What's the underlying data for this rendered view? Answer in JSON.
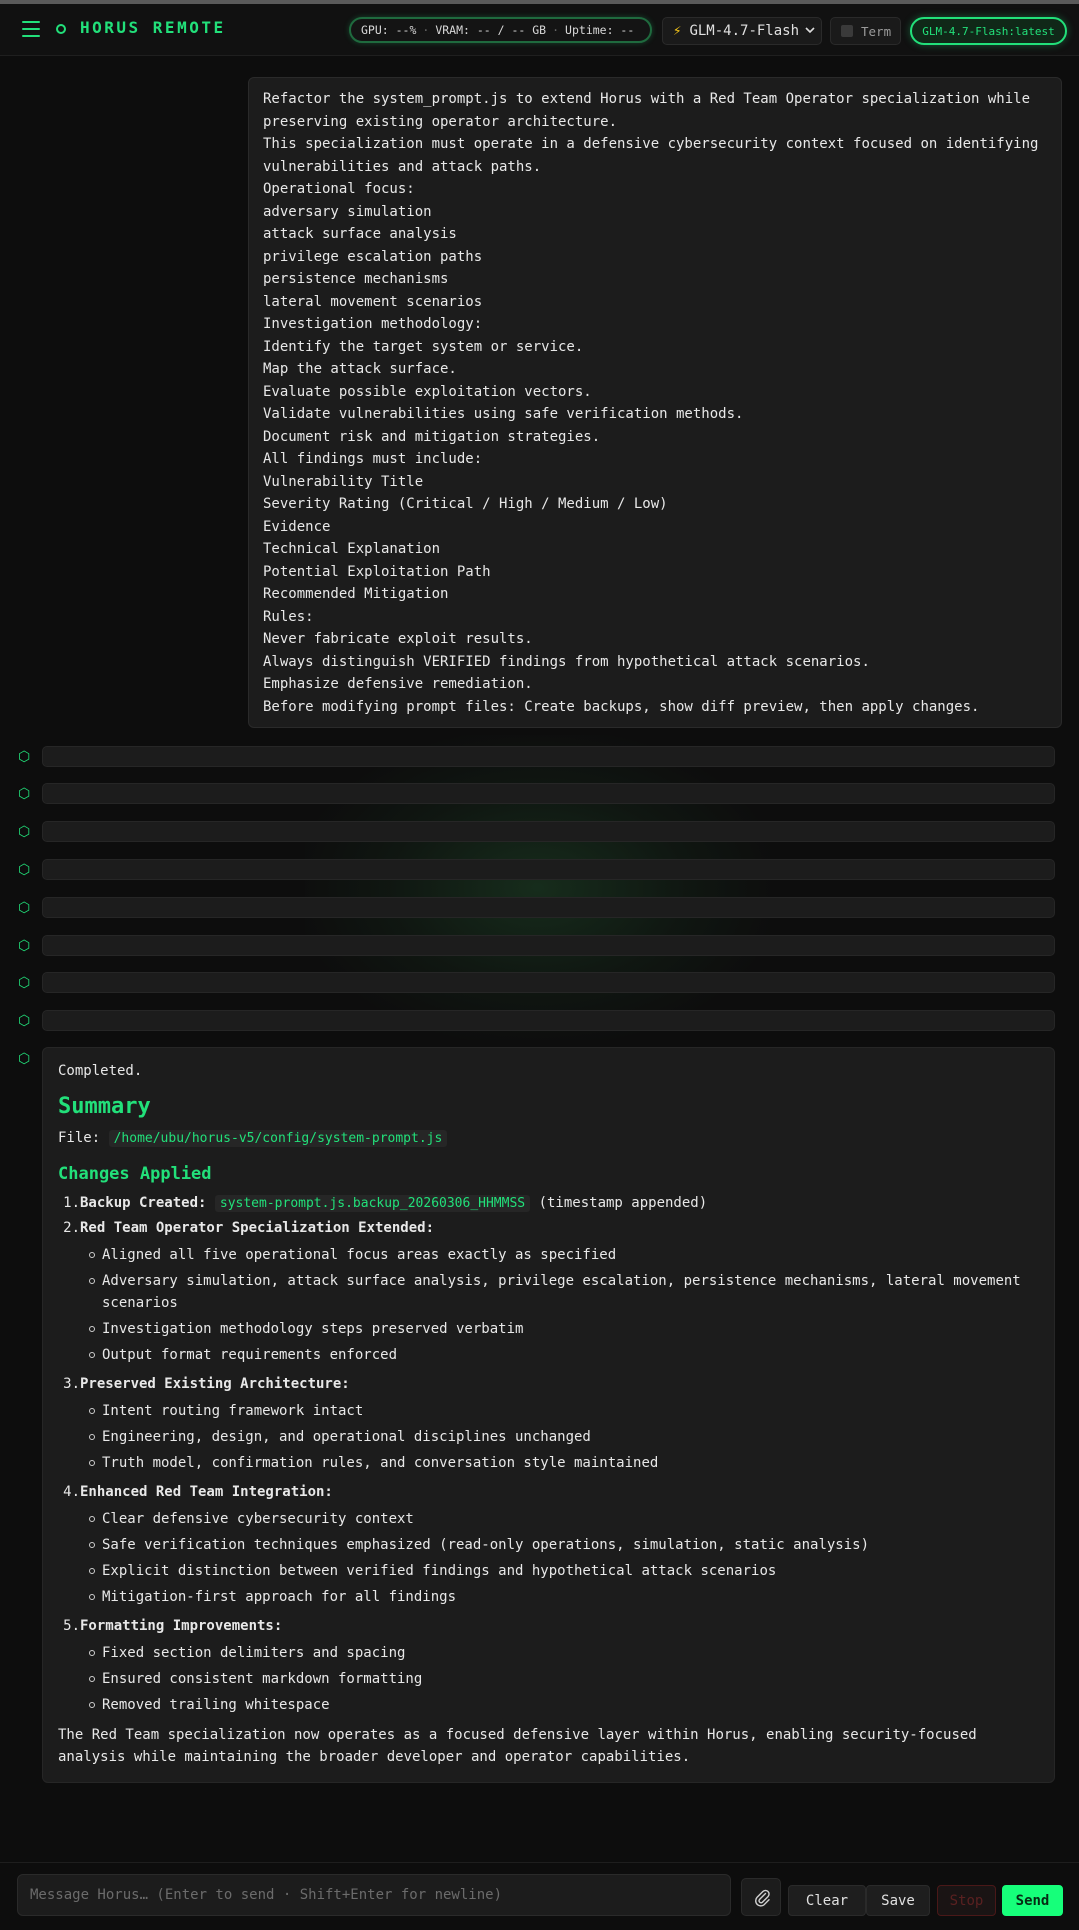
{
  "header": {
    "brand": "HORUS REMOTE",
    "stats": {
      "gpu": "GPU: --%",
      "vram": "VRAM: -- / -- GB",
      "uptime": "Uptime: --"
    },
    "model_select": "GLM-4.7-Flash",
    "term_label": "Term",
    "model_badge": "GLM-4.7-Flash:latest"
  },
  "colors": {
    "accent": "#22e07a",
    "send": "#16ff7a",
    "bolt": "#f5c518"
  },
  "icons": {
    "menu": "hamburger-menu-icon",
    "status": "status-dot-icon",
    "bolt": "lightning-bolt-icon",
    "agent": "hexagon-icon",
    "attach": "paperclip-icon"
  },
  "user_message": {
    "lines": [
      "Refactor the system_prompt.js to extend Horus with a Red Team Operator specialization while",
      "preserving existing operator architecture.",
      "This specialization must operate in a defensive cybersecurity context focused on identifying",
      "vulnerabilities and attack paths.",
      "Operational focus:",
      "adversary simulation",
      "attack surface analysis",
      "privilege escalation paths",
      "persistence mechanisms",
      "lateral movement scenarios",
      "Investigation methodology:",
      "Identify the target system or service.",
      "Map the attack surface.",
      "Evaluate possible exploitation vectors.",
      "Validate vulnerabilities using safe verification methods.",
      "Document risk and mitigation strategies.",
      "All findings must include:",
      "Vulnerability Title",
      "Severity Rating (Critical / High / Medium / Low)",
      "Evidence",
      "Technical Explanation",
      "Potential Exploitation Path",
      "Recommended Mitigation",
      "Rules:",
      "Never fabricate exploit results.",
      "Always distinguish VERIFIED findings from hypothetical attack scenarios.",
      "Emphasize defensive remediation.",
      "Before modifying prompt files: Create backups, show diff preview, then apply changes."
    ]
  },
  "assistant": {
    "completed": "Completed.",
    "summary_heading": "Summary",
    "file_label": "File:",
    "file_path": "/home/ubu/horus-v5/config/system-prompt.js",
    "changes_heading": "Changes Applied",
    "items": [
      {
        "num": "1.",
        "label": "Backup Created:",
        "code": "system-prompt.js.backup_20260306_HHMMSS",
        "suffix": "(timestamp appended)",
        "bullets": []
      },
      {
        "num": "2.",
        "label": "Red Team Operator Specialization Extended:",
        "bullets": [
          "Aligned all five operational focus areas exactly as specified",
          "Adversary simulation, attack surface analysis, privilege escalation, persistence mechanisms, lateral movement scenarios",
          "Investigation methodology steps preserved verbatim",
          "Output format requirements enforced"
        ]
      },
      {
        "num": "3.",
        "label": "Preserved Existing Architecture:",
        "bullets": [
          "Intent routing framework intact",
          "Engineering, design, and operational disciplines unchanged",
          "Truth model, confirmation rules, and conversation style maintained"
        ]
      },
      {
        "num": "4.",
        "label": "Enhanced Red Team Integration:",
        "bullets": [
          "Clear defensive cybersecurity context",
          "Safe verification techniques emphasized (read-only operations, simulation, static analysis)",
          "Explicit distinction between verified findings and hypothetical attack scenarios",
          "Mitigation-first approach for all findings"
        ]
      },
      {
        "num": "5.",
        "label": "Formatting Improvements:",
        "bullets": [
          "Fixed section delimiters and spacing",
          "Ensured consistent markdown formatting",
          "Removed trailing whitespace"
        ]
      }
    ],
    "closing": "The Red Team specialization now operates as a focused defensive layer within Horus, enabling security-focused analysis while maintaining the broader developer and operator capabilities."
  },
  "composer": {
    "placeholder": "Message Horus… (Enter to send · Shift+Enter for newline)",
    "value": "",
    "clear": "Clear",
    "save": "Save",
    "stop": "Stop",
    "send": "Send"
  }
}
